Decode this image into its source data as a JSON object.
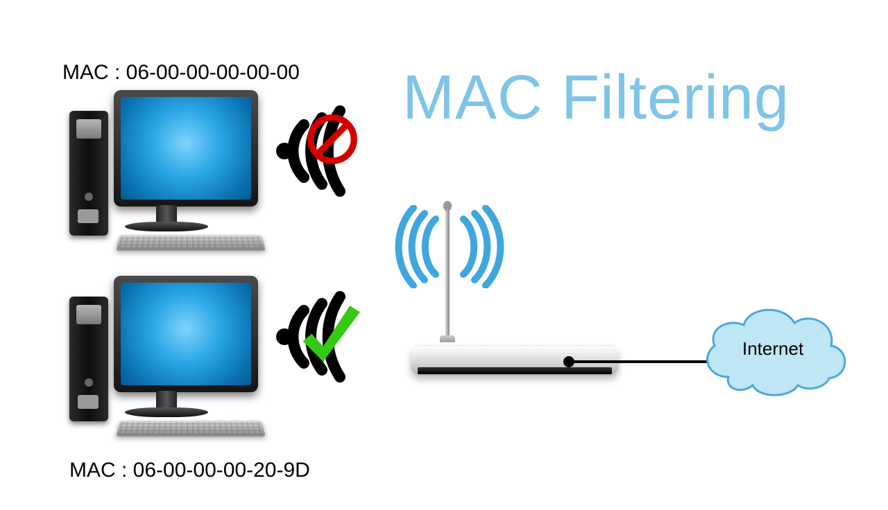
{
  "title": "MAC Filtering",
  "devices": {
    "blocked": {
      "mac_label": "MAC : 06-00-00-00-00-00"
    },
    "allowed": {
      "mac_label": "MAC : 06-00-00-00-20-9D"
    }
  },
  "internet": {
    "label": "Internet"
  },
  "colors": {
    "title": "#7fc4e8",
    "allow": "#34c912",
    "deny": "#d40000",
    "emit": "#3fa6de"
  }
}
